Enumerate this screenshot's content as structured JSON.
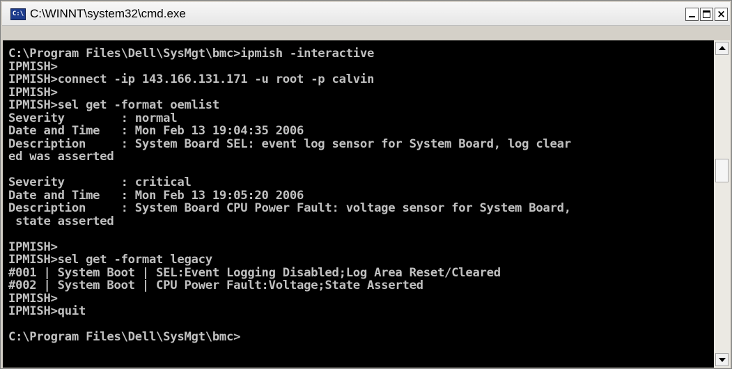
{
  "window": {
    "title": "C:\\WINNT\\system32\\cmd.exe",
    "icon_label": "C:\\",
    "buttons": {
      "minimize": "minimize-icon",
      "maximize": "maximize-icon",
      "close": "×"
    }
  },
  "console": {
    "text_color": "#c0c0c0",
    "background": "#000000",
    "lines": [
      "C:\\Program Files\\Dell\\SysMgt\\bmc>ipmish -interactive",
      "IPMISH>",
      "IPMISH>connect -ip 143.166.131.171 -u root -p calvin",
      "IPMISH>",
      "IPMISH>sel get -format oemlist",
      "Severity        : normal",
      "Date and Time   : Mon Feb 13 19:04:35 2006",
      "Description     : System Board SEL: event log sensor for System Board, log clear",
      "ed was asserted",
      "",
      "Severity        : critical",
      "Date and Time   : Mon Feb 13 19:05:20 2006",
      "Description     : System Board CPU Power Fault: voltage sensor for System Board,",
      " state asserted",
      "",
      "IPMISH>",
      "IPMISH>sel get -format legacy",
      "#001 | System Boot | SEL:Event Logging Disabled;Log Area Reset/Cleared",
      "#002 | System Boot | CPU Power Fault:Voltage;State Asserted",
      "IPMISH>",
      "IPMISH>quit",
      "",
      "C:\\Program Files\\Dell\\SysMgt\\bmc>"
    ]
  }
}
